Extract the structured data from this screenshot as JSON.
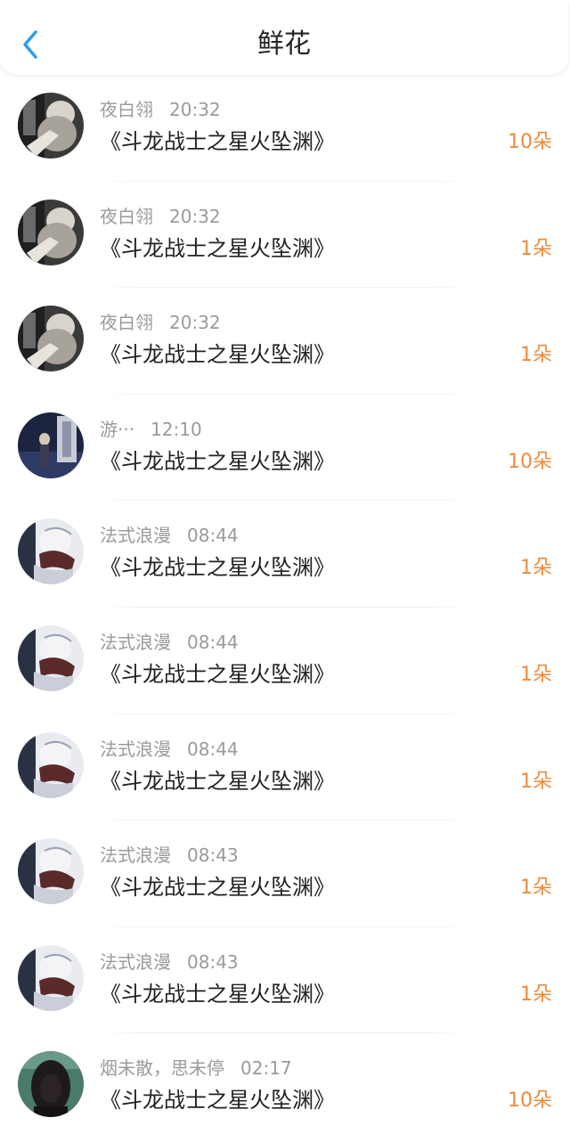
{
  "header": {
    "title": "鲜花",
    "back_icon": "chevron-left-icon",
    "accent_color": "#2a9cf0"
  },
  "count_color": "#ef8a3a",
  "items": [
    {
      "user": "夜白翎",
      "time": "20:32",
      "work": "《斗龙战士之星火坠渊》",
      "count": "10朵",
      "avatar": "avatar-a"
    },
    {
      "user": "夜白翎",
      "time": "20:32",
      "work": "《斗龙战士之星火坠渊》",
      "count": "1朵",
      "avatar": "avatar-a"
    },
    {
      "user": "夜白翎",
      "time": "20:32",
      "work": "《斗龙战士之星火坠渊》",
      "count": "1朵",
      "avatar": "avatar-a"
    },
    {
      "user": "游···",
      "time": "12:10",
      "work": "《斗龙战士之星火坠渊》",
      "count": "10朵",
      "avatar": "avatar-b"
    },
    {
      "user": "法式浪漫",
      "time": "08:44",
      "work": "《斗龙战士之星火坠渊》",
      "count": "1朵",
      "avatar": "avatar-c"
    },
    {
      "user": "法式浪漫",
      "time": "08:44",
      "work": "《斗龙战士之星火坠渊》",
      "count": "1朵",
      "avatar": "avatar-c"
    },
    {
      "user": "法式浪漫",
      "time": "08:44",
      "work": "《斗龙战士之星火坠渊》",
      "count": "1朵",
      "avatar": "avatar-c"
    },
    {
      "user": "法式浪漫",
      "time": "08:43",
      "work": "《斗龙战士之星火坠渊》",
      "count": "1朵",
      "avatar": "avatar-c"
    },
    {
      "user": "法式浪漫",
      "time": "08:43",
      "work": "《斗龙战士之星火坠渊》",
      "count": "1朵",
      "avatar": "avatar-c"
    },
    {
      "user": "烟未散，思未停",
      "time": "02:17",
      "work": "《斗龙战士之星火坠渊》",
      "count": "10朵",
      "avatar": "avatar-d"
    }
  ]
}
